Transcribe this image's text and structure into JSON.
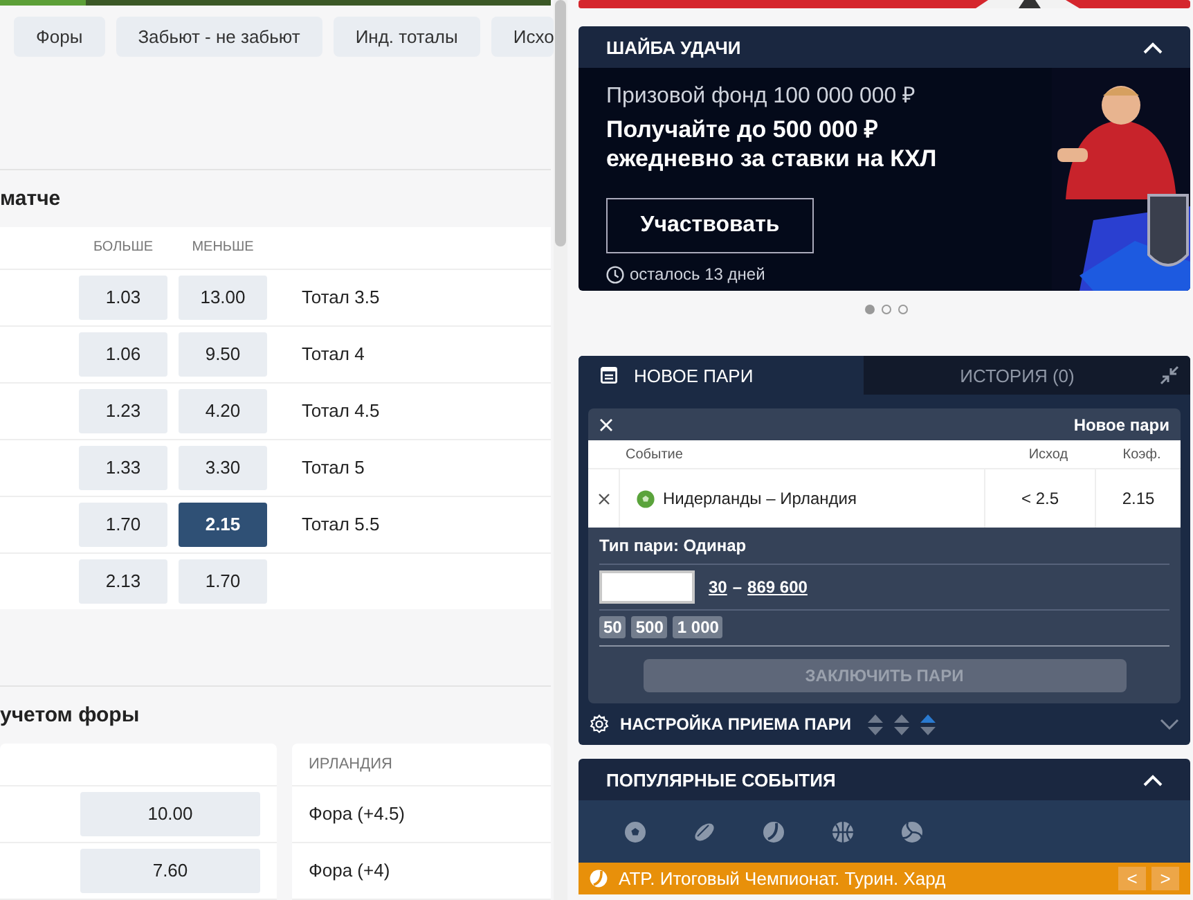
{
  "filter_tabs": [
    {
      "label": "Форы"
    },
    {
      "label": "Забьют - не забьют"
    },
    {
      "label": "Инд. тоталы"
    },
    {
      "label": "Исхо"
    }
  ],
  "totals": {
    "title": "матче",
    "columns": [
      "БОЛЬШЕ",
      "МЕНЬШЕ"
    ],
    "rows": [
      {
        "over": {
          "odds": "1.03",
          "selected": false
        },
        "under": {
          "odds": "13.00",
          "selected": false
        },
        "label": "Тотал 3.5"
      },
      {
        "over": {
          "odds": "1.06",
          "selected": false
        },
        "under": {
          "odds": "9.50",
          "selected": false
        },
        "label": "Тотал 4"
      },
      {
        "over": {
          "odds": "1.23",
          "selected": false
        },
        "under": {
          "odds": "4.20",
          "selected": false
        },
        "label": "Тотал 4.5"
      },
      {
        "over": {
          "odds": "1.33",
          "selected": false
        },
        "under": {
          "odds": "3.30",
          "selected": false
        },
        "label": "Тотал 5"
      },
      {
        "over": {
          "odds": "1.70",
          "selected": false
        },
        "under": {
          "odds": "2.15",
          "selected": true
        },
        "label": "Тотал 5.5"
      },
      {
        "over": {
          "odds": "2.13",
          "selected": false
        },
        "under": {
          "odds": "1.70",
          "selected": false
        }
      }
    ]
  },
  "handicap": {
    "title": "учетом форы",
    "left_rows": [
      {
        "odds": "10.00",
        "selected": false
      },
      {
        "odds": "7.60",
        "selected": false
      }
    ],
    "right_column": "ИРЛАНДИЯ",
    "right_rows": [
      "Фора (+4.5)",
      "Фора (+4)"
    ]
  },
  "promo": {
    "title": "ШАЙБА УДАЧИ",
    "expanded": true,
    "prize": "Призовой фонд 100 000 000 ₽",
    "headline": "Получайте до 500 000 ₽ ежедневно за ставки на КХЛ",
    "button": "Участвовать",
    "time_left": "осталось 13 дней"
  },
  "carousel_dots": [
    {
      "selected": true
    },
    {
      "selected": false
    },
    {
      "selected": false
    }
  ],
  "bet_slip": {
    "tabs": [
      {
        "label": "НОВОЕ ПАРИ",
        "selected": true
      },
      {
        "label": "ИСТОРИЯ (0)",
        "selected": false
      }
    ],
    "title": "Новое пари",
    "columns": [
      "Событие",
      "Исход",
      "Коэф."
    ],
    "bets": [
      {
        "event": "Нидерланды – Ирландия",
        "outcome": "< 2.5",
        "odds": "2.15"
      }
    ],
    "bet_type": "Тип пари: Одинар",
    "stake_min": "30",
    "stake_sep": "–",
    "stake_max": "869 600",
    "quick_stakes": [
      "50",
      "500",
      "1 000"
    ],
    "submit": {
      "label": "ЗАКЛЮЧИТЬ ПАРИ",
      "disabled": true
    },
    "settings": {
      "label": "НАСТРОЙКА ПРИЕМА ПАРИ",
      "options": [
        {
          "selected": false
        },
        {
          "selected": false
        },
        {
          "selected": true
        }
      ],
      "expanded": false
    }
  },
  "popular": {
    "title": "ПОПУЛЯРНЫЕ СОБЫТИЯ",
    "expanded": true,
    "sports": [
      {
        "kind": "soccer"
      },
      {
        "kind": "hockey"
      },
      {
        "kind": "tennis"
      },
      {
        "kind": "basketball"
      },
      {
        "kind": "volleyball"
      }
    ],
    "tournament": "ATP. Итоговый Чемпионат. Турин. Хард",
    "nav": [
      "<",
      ">"
    ]
  }
}
